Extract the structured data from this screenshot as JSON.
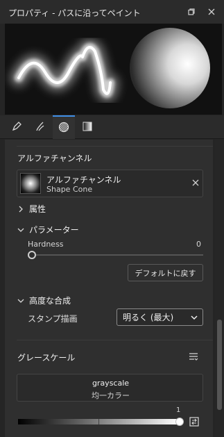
{
  "window": {
    "title": "プロパティ - パスに沿ってペイント"
  },
  "tabs": [
    {
      "icon": "pen-icon",
      "active": false
    },
    {
      "icon": "brush-stroke-icon",
      "active": false
    },
    {
      "icon": "checker-circle-icon",
      "active": true
    },
    {
      "icon": "gradient-square-icon",
      "active": false
    }
  ],
  "alpha_channel": {
    "heading": "アルファチャンネル",
    "item_name": "アルファチャンネル",
    "item_sub": "Shape Cone"
  },
  "attributes": {
    "label": "属性",
    "expanded": false
  },
  "parameters": {
    "label": "パラメーター",
    "expanded": true,
    "hardness_label": "Hardness",
    "hardness_value": "0",
    "reset_button": "デフォルトに戻す"
  },
  "advanced": {
    "label": "高度な合成",
    "expanded": true,
    "stamp_label": "スタンプ描画",
    "stamp_value": "明るく (最大)"
  },
  "grayscale": {
    "heading": "グレースケール",
    "item_name": "grayscale",
    "item_sub": "均一カラー",
    "stop_value": "1"
  },
  "colors": {
    "accent": "#3f8ee6",
    "background": "#2f2f2f"
  }
}
